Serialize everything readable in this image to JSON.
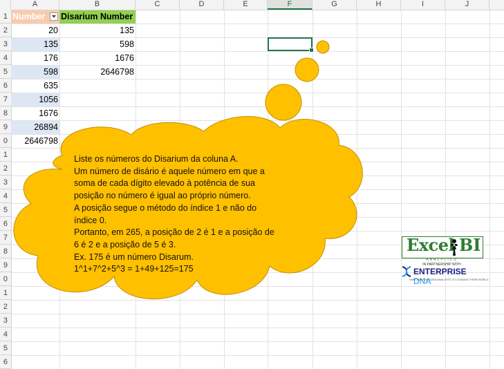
{
  "columns": [
    "A",
    "B",
    "C",
    "D",
    "E",
    "F",
    "G",
    "H",
    "I",
    "J"
  ],
  "selected_column": "F",
  "rows": [
    "1",
    "2",
    "3",
    "4",
    "5",
    "6",
    "7",
    "8",
    "9",
    "0",
    "1",
    "2",
    "3",
    "4",
    "5",
    "6",
    "7",
    "8",
    "9",
    "0",
    "1",
    "2",
    "3",
    "4",
    "5",
    "6"
  ],
  "table": {
    "header_a": "Number",
    "header_b": "Disarium Number",
    "col_a": [
      "20",
      "135",
      "176",
      "598",
      "635",
      "1056",
      "1676",
      "26894",
      "2646798"
    ],
    "col_b": [
      "135",
      "598",
      "1676",
      "2646798"
    ]
  },
  "cloud_lines": [
    "Liste os números do Disarium da coluna A.",
    "Um número de disário é aquele número em que a",
    "soma de cada dígito elevado à potência de sua",
    "posição no número é igual ao próprio número.",
    "A posição segue o método do índice 1 e não do",
    "índice 0.",
    "Portanto, em 265, a posição de 2 é 1 e a posição de",
    "6 é 2 e a posição de 5 é 3.",
    "Ex. 175 é um número Disarum.",
    "1^1+7^2+5^3 = 1+49+125=175"
  ],
  "logo": {
    "excel": "Excel",
    "bi": "BI",
    "analytics": "ANALYTICS",
    "partner": "IN PARTNERSHIP WITH",
    "enterprise": "ENTERPRISE",
    "dna": "DNA",
    "tagline": "EMPOWERING DATA ANALYSTS TO CHANGE THEIR WORLD"
  },
  "colors": {
    "cloud_fill": "#ffc000",
    "cloud_stroke": "#bf9000",
    "header_a_fill": "#f8cbad",
    "header_b_fill": "#92d050",
    "row_band": "#dde7f4",
    "selection": "#217346"
  }
}
